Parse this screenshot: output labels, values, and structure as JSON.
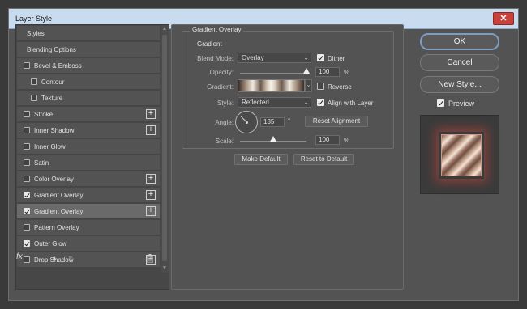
{
  "window": {
    "title": "Layer Style",
    "close_glyph": "✕"
  },
  "styles_list": [
    {
      "label": "Styles",
      "checkbox": false,
      "checked": false,
      "plus": false,
      "indent": 0
    },
    {
      "label": "Blending Options",
      "checkbox": false,
      "checked": false,
      "plus": false,
      "indent": 0
    },
    {
      "label": "Bevel & Emboss",
      "checkbox": true,
      "checked": false,
      "plus": false,
      "indent": 0
    },
    {
      "label": "Contour",
      "checkbox": true,
      "checked": false,
      "plus": false,
      "indent": 1
    },
    {
      "label": "Texture",
      "checkbox": true,
      "checked": false,
      "plus": false,
      "indent": 1
    },
    {
      "label": "Stroke",
      "checkbox": true,
      "checked": false,
      "plus": true,
      "indent": 0
    },
    {
      "label": "Inner Shadow",
      "checkbox": true,
      "checked": false,
      "plus": true,
      "indent": 0
    },
    {
      "label": "Inner Glow",
      "checkbox": true,
      "checked": false,
      "plus": false,
      "indent": 0
    },
    {
      "label": "Satin",
      "checkbox": true,
      "checked": false,
      "plus": false,
      "indent": 0
    },
    {
      "label": "Color Overlay",
      "checkbox": true,
      "checked": false,
      "plus": true,
      "indent": 0
    },
    {
      "label": "Gradient Overlay",
      "checkbox": true,
      "checked": true,
      "plus": true,
      "indent": 0
    },
    {
      "label": "Gradient Overlay",
      "checkbox": true,
      "checked": true,
      "plus": true,
      "indent": 0,
      "selected": true
    },
    {
      "label": "Pattern Overlay",
      "checkbox": true,
      "checked": false,
      "plus": false,
      "indent": 0
    },
    {
      "label": "Outer Glow",
      "checkbox": true,
      "checked": true,
      "plus": false,
      "indent": 0
    },
    {
      "label": "Drop Shadow",
      "checkbox": true,
      "checked": false,
      "plus": true,
      "indent": 0
    }
  ],
  "footer": {
    "fx_label": "fx",
    "fx_icon": "fx-icon",
    "up_icon": "arrow-up-icon",
    "down_icon": "arrow-down-icon",
    "trash_icon": "trash-icon"
  },
  "gradient_overlay": {
    "group_title": "Gradient Overlay",
    "sub_title": "Gradient",
    "blend_mode_label": "Blend Mode:",
    "blend_mode_value": "Overlay",
    "dither_label": "Dither",
    "dither_checked": true,
    "opacity_label": "Opacity:",
    "opacity_value": "100",
    "opacity_level": 1.0,
    "opacity_unit": "%",
    "gradient_label": "Gradient:",
    "reverse_label": "Reverse",
    "reverse_checked": false,
    "style_label": "Style:",
    "style_value": "Reflected",
    "align_label": "Align with Layer",
    "align_checked": true,
    "angle_label": "Angle:",
    "angle_value": "135",
    "angle_unit": "°",
    "reset_alignment_label": "Reset Alignment",
    "scale_label": "Scale:",
    "scale_value": "100",
    "scale_level": 0.5,
    "scale_unit": "%",
    "make_default_label": "Make Default",
    "reset_default_label": "Reset to Default"
  },
  "actions": {
    "ok_label": "OK",
    "cancel_label": "Cancel",
    "new_style_label": "New Style...",
    "preview_label": "Preview",
    "preview_checked": true
  }
}
